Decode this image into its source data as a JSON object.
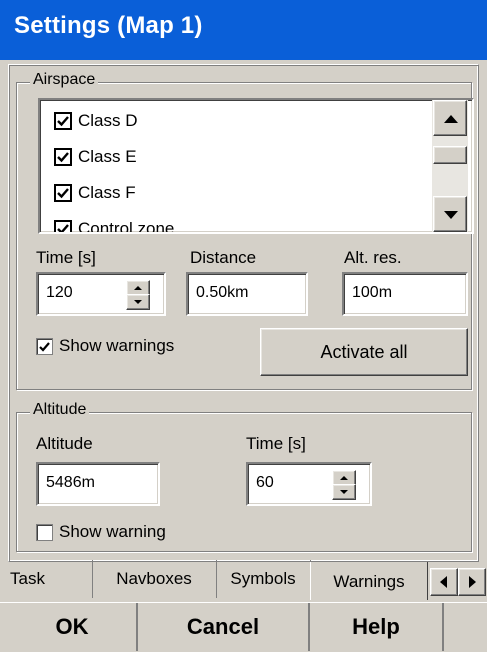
{
  "window": {
    "title": "Settings (Map 1)"
  },
  "airspace": {
    "group_label": "Airspace",
    "classes": [
      {
        "label": "Class D",
        "checked": true
      },
      {
        "label": "Class E",
        "checked": true
      },
      {
        "label": "Class F",
        "checked": true
      },
      {
        "label": "Control zone",
        "checked": true
      }
    ],
    "time_label": "Time [s]",
    "time_value": "120",
    "distance_label": "Distance",
    "distance_value": "0.50km",
    "altres_label": "Alt. res.",
    "altres_value": "100m",
    "show_warnings_label": "Show warnings",
    "show_warnings_checked": true,
    "activate_all_label": "Activate all"
  },
  "altitude": {
    "group_label": "Altitude",
    "altitude_label": "Altitude",
    "altitude_value": "5486m",
    "time_label": "Time [s]",
    "time_value": "60",
    "show_warning_label": "Show warning",
    "show_warning_checked": false
  },
  "tabs": {
    "items": [
      "Task",
      "Navboxes",
      "Symbols",
      "Warnings"
    ],
    "selected": "Warnings"
  },
  "buttons": {
    "ok": "OK",
    "cancel": "Cancel",
    "help": "Help"
  }
}
